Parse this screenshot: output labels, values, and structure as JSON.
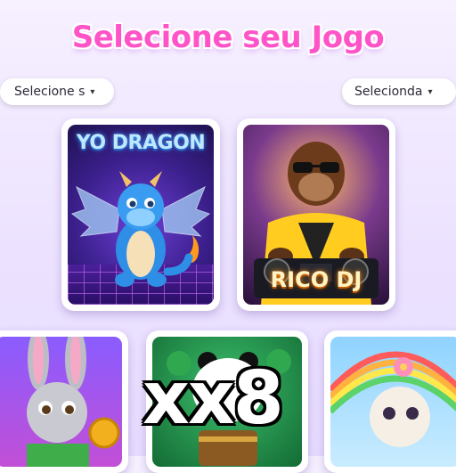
{
  "header": {
    "title": "Selecione seu Jogo"
  },
  "filters": {
    "left": {
      "label": "Selecione s",
      "caret": "▾"
    },
    "right": {
      "label": "Selecionda",
      "caret": "▾"
    }
  },
  "games": [
    {
      "title": "YO DRAGON"
    },
    {
      "title": "RICO DJ"
    }
  ],
  "overlay": {
    "multiplier": "xx8"
  },
  "colors": {
    "title": "#ff54c8",
    "background": "#ece2ff",
    "card_border": "#ffffff"
  }
}
